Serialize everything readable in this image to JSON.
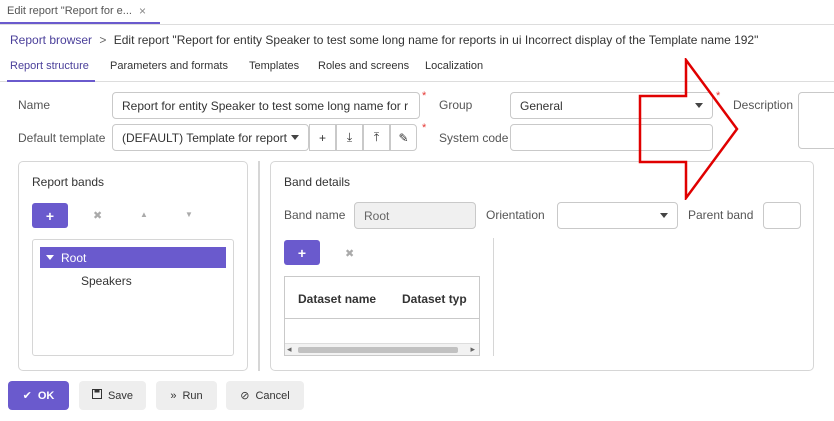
{
  "window": {
    "tab_title": "Edit report \"Report for e...",
    "tab_close": "×"
  },
  "breadcrumb": {
    "root": "Report browser",
    "sep": ">",
    "current": "Edit report \"Report for entity Speaker to test some long name for reports in ui Incorrect display of the Template name 192\""
  },
  "tabs": [
    "Report structure",
    "Parameters and formats",
    "Templates",
    "Roles and screens",
    "Localization"
  ],
  "form": {
    "name_label": "Name",
    "name_value": "Report for entity Speaker to test some long name for r",
    "group_label": "Group",
    "group_value": "General",
    "description_label": "Description",
    "default_template_label": "Default template",
    "default_template_value": "(DEFAULT) Template for report",
    "system_code_label": "System code",
    "system_code_value": "",
    "required_mark": "*"
  },
  "template_buttons": [
    "+",
    "⤓",
    "⤒",
    "✎"
  ],
  "report_bands": {
    "title": "Report bands",
    "add": "+",
    "remove": "✖",
    "up": "▲",
    "down": "▼",
    "tree": {
      "root": "Root",
      "child": "Speakers"
    }
  },
  "band_details": {
    "title": "Band details",
    "band_name_label": "Band name",
    "band_name_value": "Root",
    "orientation_label": "Orientation",
    "orientation_value": "",
    "parent_band_label": "Parent band",
    "parent_band_value": "",
    "add": "+",
    "remove": "✖",
    "columns": [
      "Dataset name",
      "Dataset typ"
    ],
    "scroll_left": "◂",
    "scroll_right": "▸"
  },
  "footer": {
    "ok": "OK",
    "save": "Save",
    "run": "Run",
    "cancel": "Cancel",
    "ok_icon": "✔",
    "save_icon": "💾",
    "run_icon": "»",
    "cancel_icon": "⊘"
  },
  "colors": {
    "accent": "#6a5acd",
    "required": "#e53935",
    "annotation_arrow": "#e00000"
  }
}
